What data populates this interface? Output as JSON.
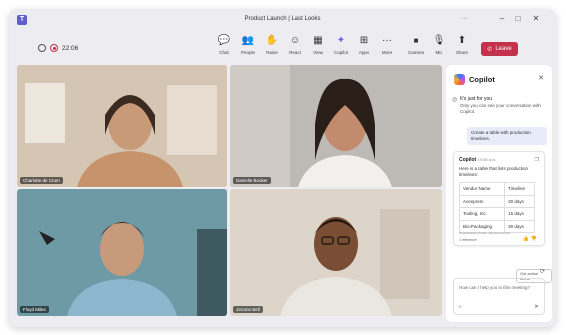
{
  "window": {
    "app_icon_glyph": "T",
    "title": "Product Launch | Last Looks",
    "more_glyph": "···",
    "controls": {
      "minimize": "–",
      "maximize": "□",
      "close": "✕"
    }
  },
  "meeting": {
    "timer": "22:06",
    "toolbar": [
      {
        "label": "Chat",
        "icon": "chat-icon",
        "glyph": "💬"
      },
      {
        "label": "People",
        "icon": "people-icon",
        "glyph": "👥"
      },
      {
        "label": "Raise",
        "icon": "raise-hand-icon",
        "glyph": "✋"
      },
      {
        "label": "React",
        "icon": "react-icon",
        "glyph": "☺"
      },
      {
        "label": "View",
        "icon": "view-icon",
        "glyph": "▦"
      },
      {
        "label": "Copilot",
        "icon": "copilot-icon",
        "glyph": "✦"
      },
      {
        "label": "Apps",
        "icon": "apps-icon",
        "glyph": "⊞"
      },
      {
        "label": "More",
        "icon": "more-icon",
        "glyph": "···"
      },
      {
        "label": "Camera",
        "icon": "camera-icon",
        "glyph": "■"
      },
      {
        "label": "Mic",
        "icon": "mic-icon",
        "glyph": "🎙"
      },
      {
        "label": "Share",
        "icon": "share-icon",
        "glyph": "⬆"
      }
    ],
    "leave_label": "Leave",
    "leave_glyph": "✆"
  },
  "participants": [
    {
      "name": "Charlotte de Crum",
      "bg": "#c9b8a4"
    },
    {
      "name": "Danielle Booker",
      "bg": "#b9b7b5"
    },
    {
      "name": "Floyd Miles",
      "bg": "#5d8e9c"
    },
    {
      "name": "Jerome Bell",
      "bg": "#d8cec4"
    }
  ],
  "copilot": {
    "title": "Copilot",
    "notice_title": "It's just for you",
    "notice_body": "Only you can see your conversation with Copilot.",
    "user_prompt": "Create a table with production timelines.",
    "response_name": "Copilot",
    "response_time": "10:35 a.m.",
    "response_text": "Here is a table that lists production timelines:",
    "table": [
      [
        "Vendor Name",
        "Timeline"
      ],
      [
        "Acenprem",
        "30 days"
      ],
      [
        "Tooling, Inc.",
        "15 days"
      ],
      [
        "Bio-Packaging",
        "30 days"
      ]
    ],
    "ai_note": "AI-generated content may be incorrect",
    "reference": "1 reference",
    "action_button": "Get action items",
    "input_placeholder": "How can I help you in this meeting?"
  },
  "colors": {
    "brand": "#5b5fc7",
    "leave": "#c4314b"
  }
}
